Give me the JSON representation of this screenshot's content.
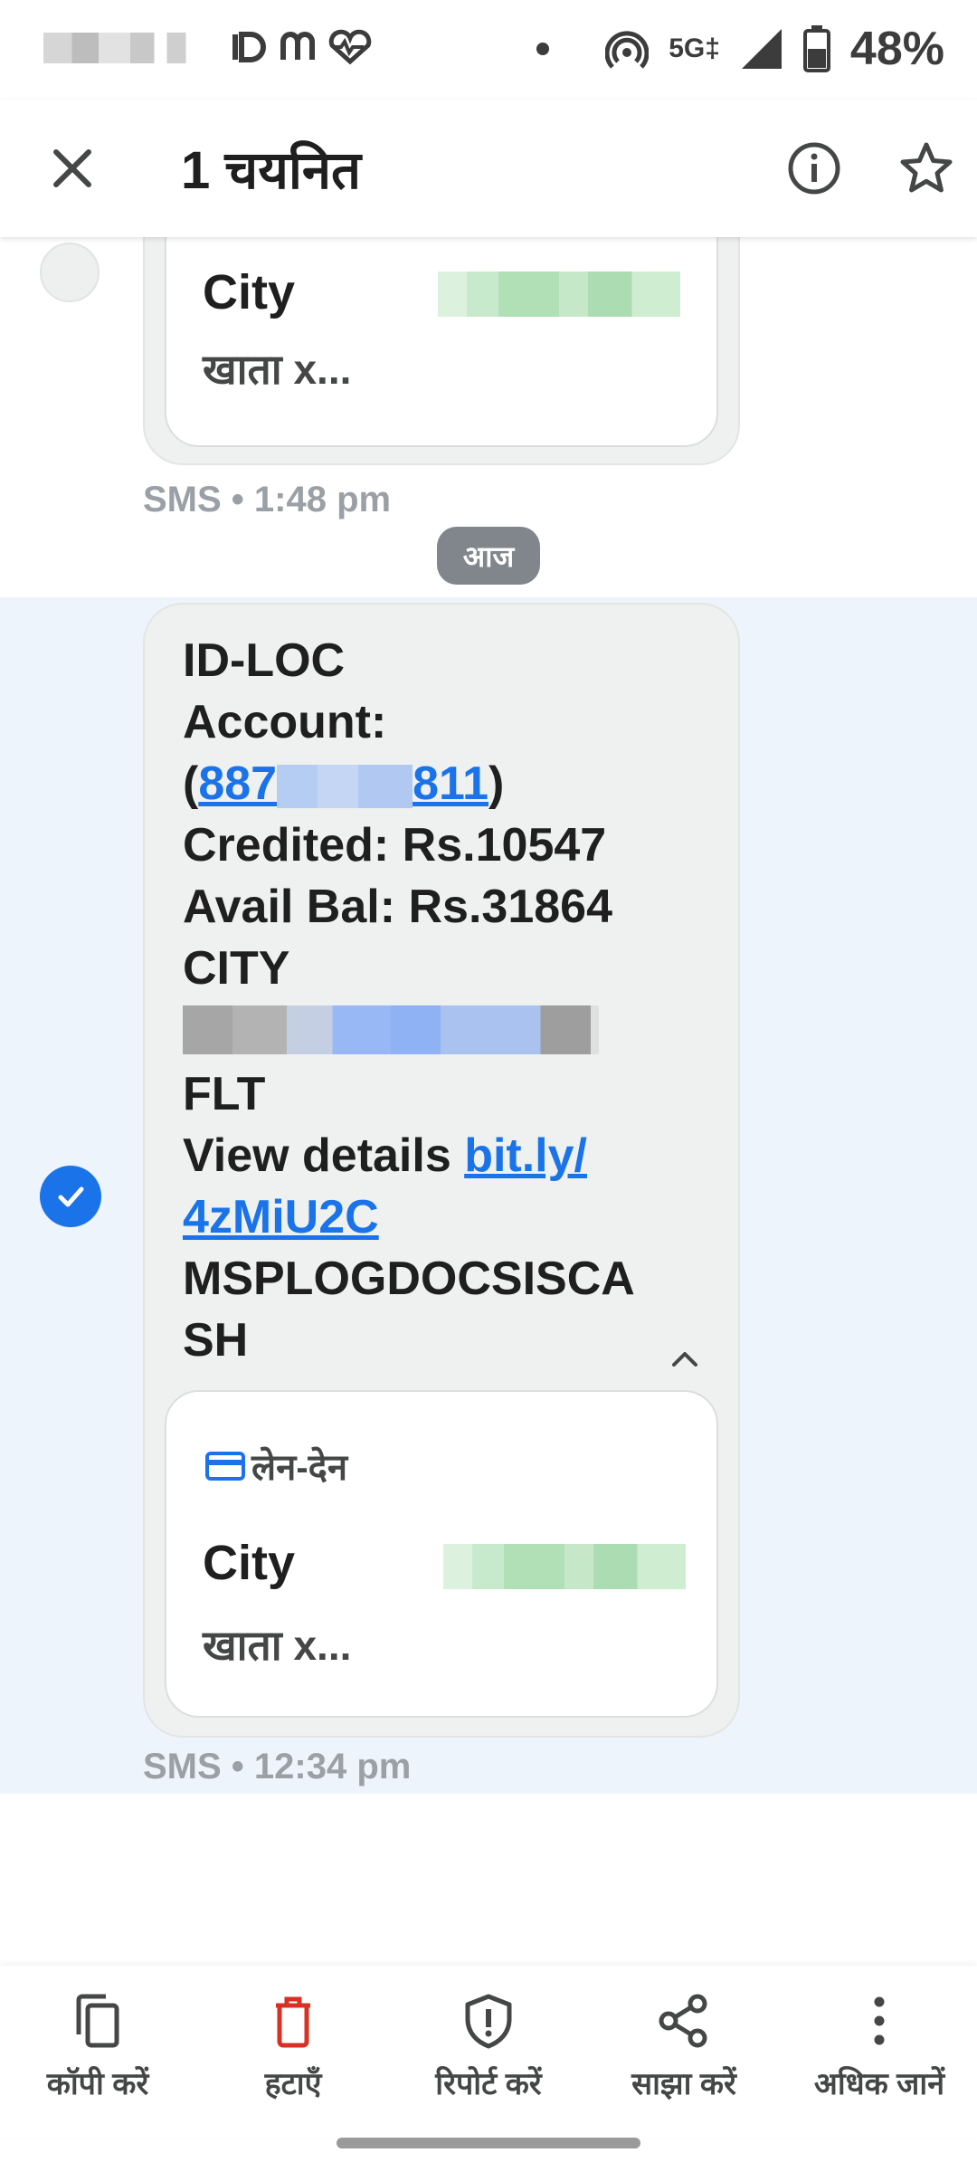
{
  "status_bar": {
    "network": "5G‡",
    "battery_pct": "48%"
  },
  "app_bar": {
    "title": "1 चयनित",
    "close_icon": "close-icon",
    "info_icon": "info-icon",
    "star_icon": "star-icon"
  },
  "messages": {
    "prev": {
      "card_city": "City",
      "card_account": "खाता x...",
      "meta": "SMS • 1:48 pm"
    },
    "date_chip": "आज",
    "selected": {
      "lines": {
        "l1": "ID-LOC",
        "l2": "Account:",
        "l3_open": "(",
        "l3_link_start": "887",
        "l3_link_end": "811",
        "l3_close": ")",
        "l4": "Credited: Rs.10547",
        "l5": "Avail Bal: Rs.31864",
        "l6": "CITY",
        "l8": "FLT",
        "l9_text": "View details ",
        "l9_link": "bit.ly/",
        "l10_link": "4zMiU2C",
        "l11": "MSPLOGDOCSISCA",
        "l12": "SH"
      },
      "txn_label": "लेन-देन",
      "card_city": "City",
      "card_account": "खाता x...",
      "meta": "SMS • 12:34 pm"
    }
  },
  "bottom_actions": {
    "copy": "कॉपी करें",
    "delete": "हटाएँ",
    "report": "रिपोर्ट करें",
    "share": "साझा करें",
    "more": "अधिक जानें"
  },
  "colors": {
    "accent": "#1a73e8",
    "delete": "#d93025",
    "selected_bg": "#eef4fb"
  }
}
